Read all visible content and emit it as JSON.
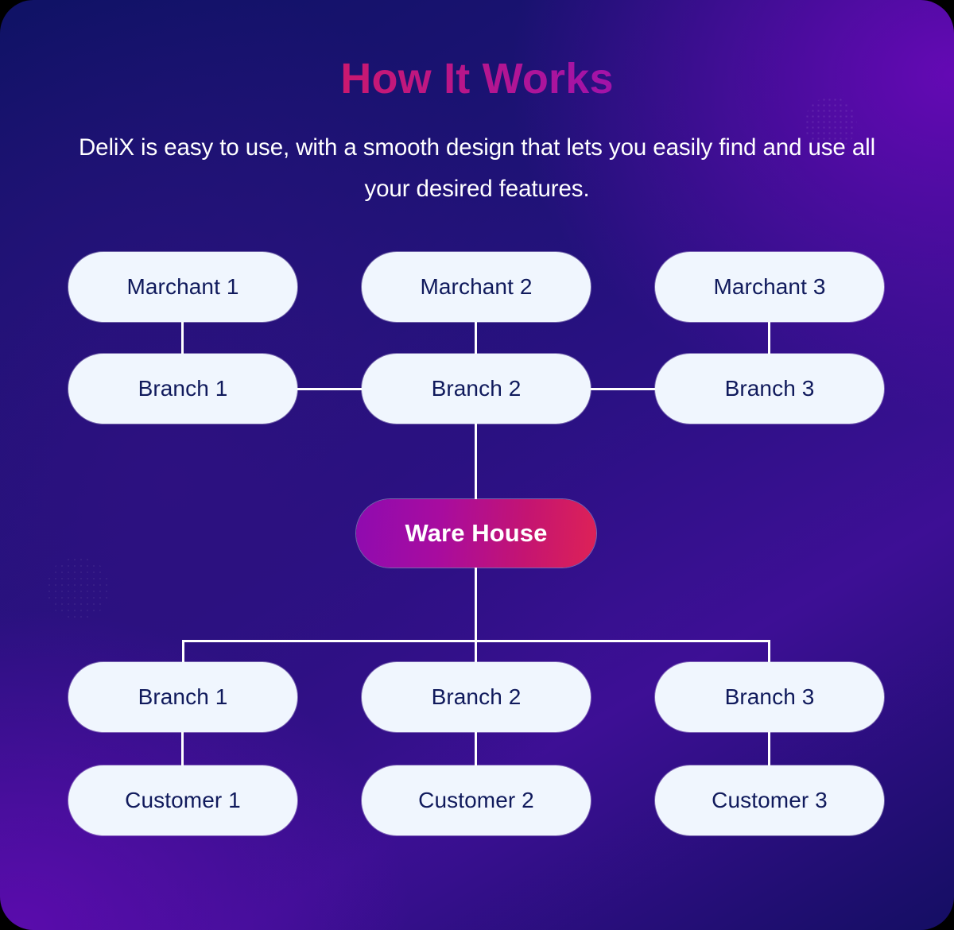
{
  "header": {
    "title": "How It Works",
    "subtitle": "DeliX is easy to use, with a smooth design that lets you easily find and use all your desired features."
  },
  "colors": {
    "background_navy": "#0f1265",
    "background_purple": "#5c09a8",
    "title_gradient_start": "#e8263c",
    "title_gradient_end": "#8f0dc0",
    "node_fill": "#f0f6fe",
    "node_text": "#101a5c",
    "warehouse_gradient_start": "#8f0bb0",
    "warehouse_gradient_end": "#de2256",
    "connector_line": "#ffffff"
  },
  "diagram": {
    "type": "org-chart",
    "rows": [
      {
        "name": "merchants",
        "nodes": [
          {
            "id": "merchant-1",
            "label": "Marchant 1"
          },
          {
            "id": "merchant-2",
            "label": "Marchant 2"
          },
          {
            "id": "merchant-3",
            "label": "Marchant 3"
          }
        ]
      },
      {
        "name": "upper-branches",
        "nodes": [
          {
            "id": "upper-branch-1",
            "label": "Branch 1"
          },
          {
            "id": "upper-branch-2",
            "label": "Branch 2"
          },
          {
            "id": "upper-branch-3",
            "label": "Branch 3"
          }
        ]
      },
      {
        "name": "warehouse",
        "nodes": [
          {
            "id": "warehouse",
            "label": "Ware House"
          }
        ]
      },
      {
        "name": "lower-branches",
        "nodes": [
          {
            "id": "lower-branch-1",
            "label": "Branch 1"
          },
          {
            "id": "lower-branch-2",
            "label": "Branch 2"
          },
          {
            "id": "lower-branch-3",
            "label": "Branch 3"
          }
        ]
      },
      {
        "name": "customers",
        "nodes": [
          {
            "id": "customer-1",
            "label": "Customer 1"
          },
          {
            "id": "customer-2",
            "label": "Customer 2"
          },
          {
            "id": "customer-3",
            "label": "Customer 3"
          }
        ]
      }
    ],
    "connections": [
      "Marchant 1 -> Branch 1",
      "Marchant 2 -> Branch 2",
      "Marchant 3 -> Branch 3",
      "Branch 1 -> Branch 2",
      "Branch 3 -> Branch 2",
      "Branch 2 -> Ware House",
      "Ware House -> Branch 1 / Branch 2 / Branch 3",
      "Branch 1 -> Customer 1",
      "Branch 2 -> Customer 2",
      "Branch 3 -> Customer 3"
    ]
  }
}
